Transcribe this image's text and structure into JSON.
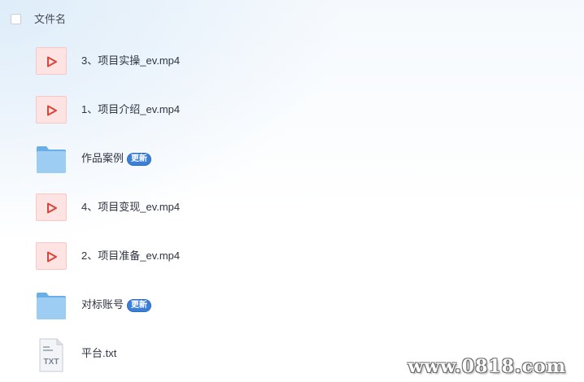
{
  "header": {
    "column_label": "文件名"
  },
  "files": [
    {
      "name": "3、项目实操_ev.mp4",
      "icon": "video-file-icon",
      "badge": ""
    },
    {
      "name": "1、项目介绍_ev.mp4",
      "icon": "video-file-icon",
      "badge": ""
    },
    {
      "name": "作品案例",
      "icon": "folder-icon",
      "badge": "更新"
    },
    {
      "name": "4、项目变现_ev.mp4",
      "icon": "video-file-icon",
      "badge": ""
    },
    {
      "name": "2、项目准备_ev.mp4",
      "icon": "video-file-icon",
      "badge": ""
    },
    {
      "name": "对标账号",
      "icon": "folder-icon",
      "badge": "更新"
    },
    {
      "name": "平台.txt",
      "icon": "txt-file-icon",
      "badge": ""
    }
  ],
  "txt_icon_label": "TXT",
  "watermark": "www.0818.com",
  "colors": {
    "video_icon_bg": "#fde3e1",
    "video_play": "#d9453b",
    "folder": "#8cc3ee",
    "badge": "#3c7fd6"
  }
}
